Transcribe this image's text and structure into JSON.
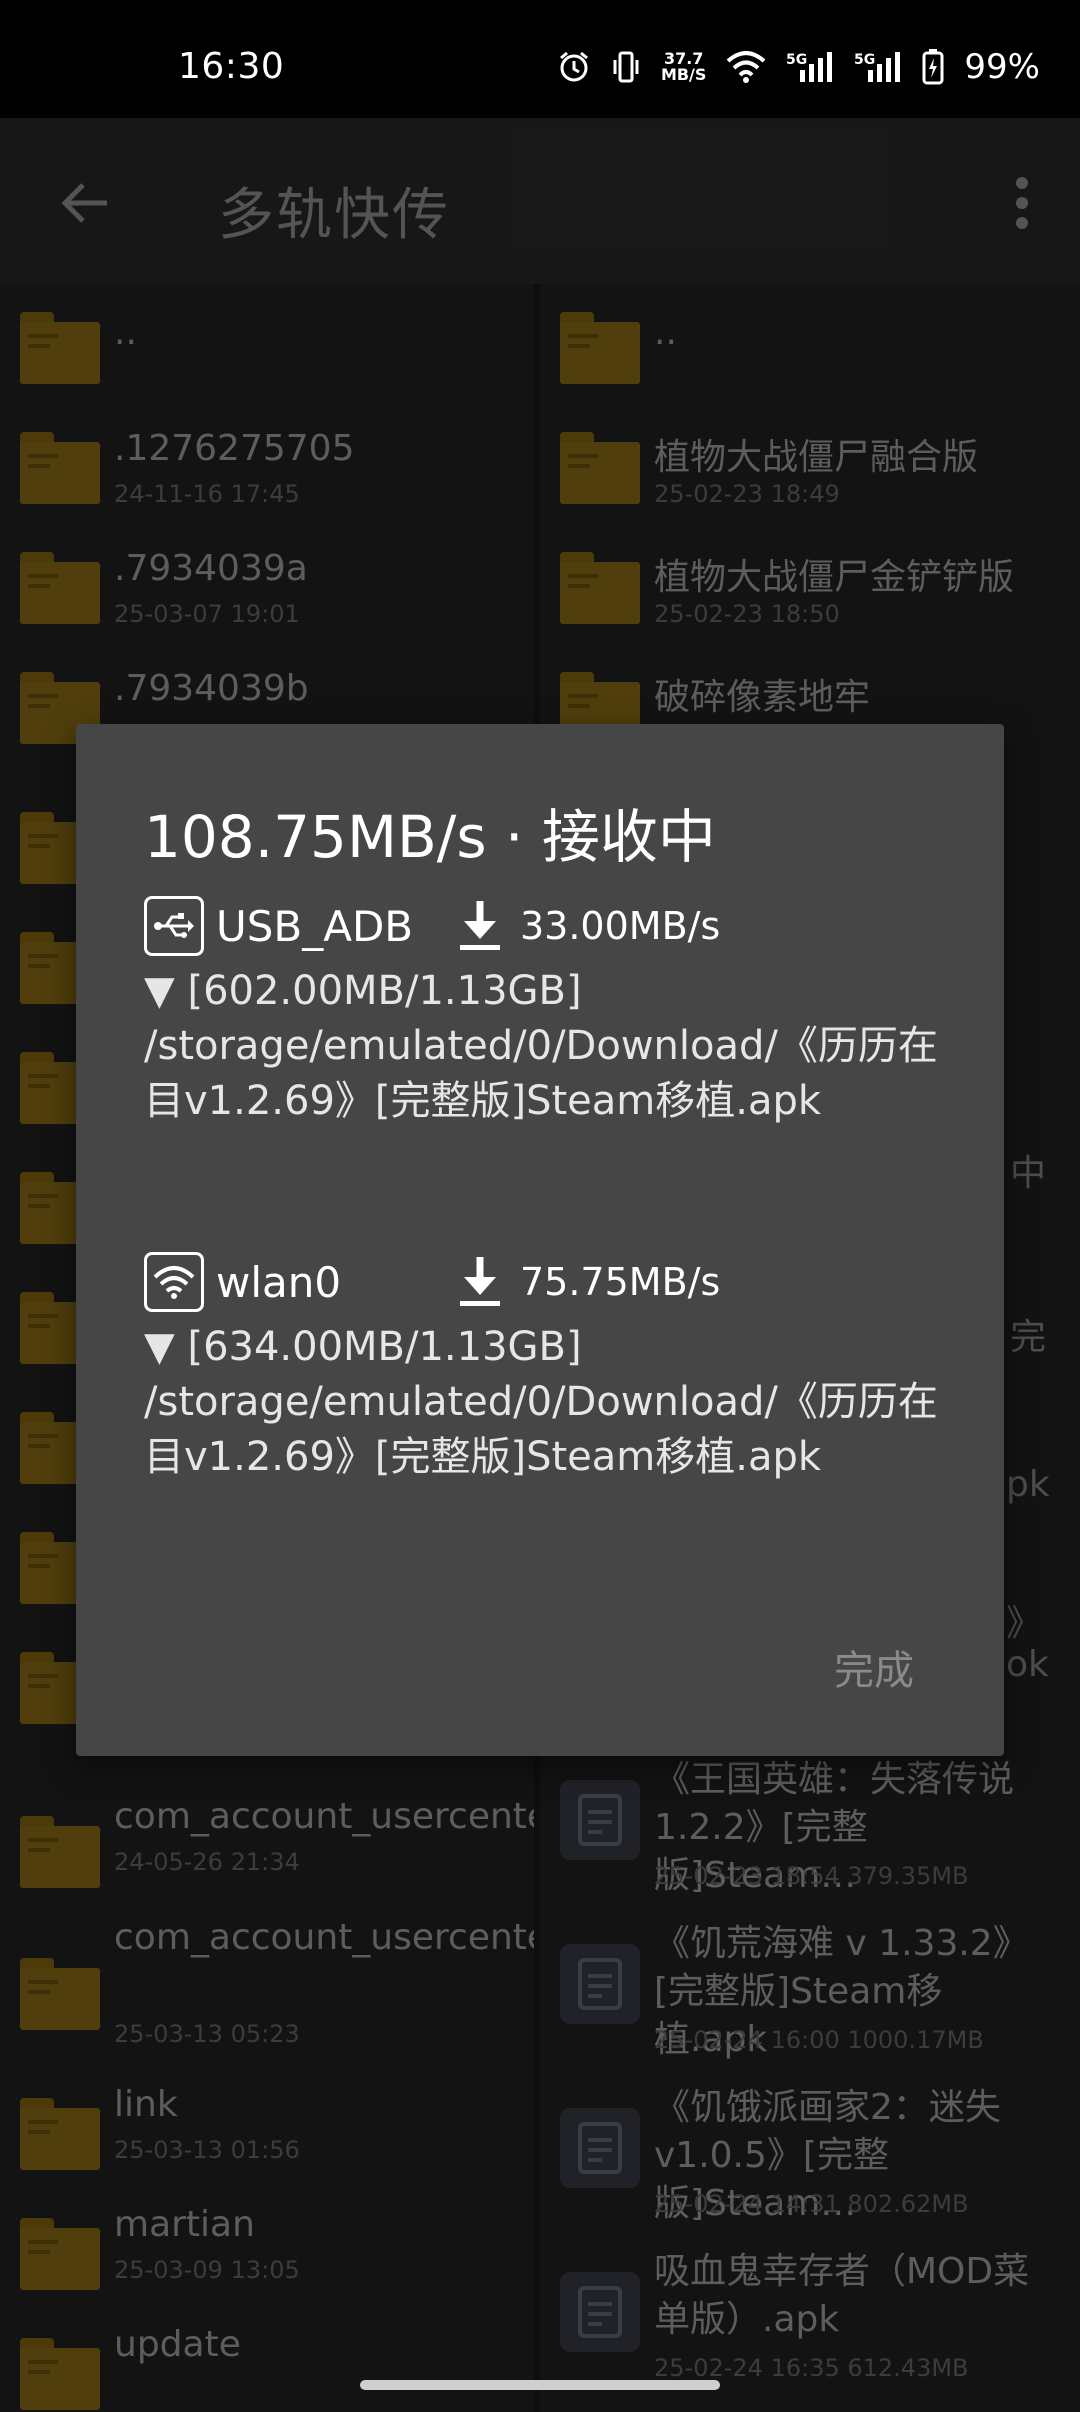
{
  "status_bar": {
    "time": "16:30",
    "net_speed_value": "37.7",
    "net_speed_unit": "MB/S",
    "battery": "99%",
    "icons": [
      "alarm-icon",
      "vibrate-icon",
      "wifi-icon",
      "signal-5g-icon",
      "signal-5g-icon",
      "battery-charging-icon"
    ]
  },
  "app_bar": {
    "title": "多轨快传",
    "back_icon": "arrow-left-icon",
    "menu_icon": "more-vert-icon"
  },
  "left_pane": {
    "items": [
      {
        "name": "..",
        "meta": ""
      },
      {
        "name": ".1276275705",
        "meta": "24-11-16 17:45"
      },
      {
        "name": ".7934039a",
        "meta": "25-03-07 19:01"
      },
      {
        "name": ".7934039b",
        "meta": ""
      },
      {
        "name": "com_account_usercenter",
        "meta": "24-05-26 21:34"
      },
      {
        "name": "com_account_usercenter_new",
        "meta": "25-03-13 05:23"
      },
      {
        "name": "link",
        "meta": "25-03-13 01:56"
      },
      {
        "name": "martian",
        "meta": "25-03-09 13:05"
      },
      {
        "name": "update",
        "meta": ""
      }
    ]
  },
  "right_pane": {
    "folders": [
      {
        "name": "..",
        "meta": ""
      },
      {
        "name": "植物大战僵尸融合版",
        "meta": "25-02-23 18:49"
      },
      {
        "name": "植物大战僵尸金铲铲版",
        "meta": "25-02-23 18:50"
      },
      {
        "name": "破碎像素地牢",
        "meta": ""
      }
    ],
    "partial": {
      "p1": "中",
      "p2": "完",
      "p3": "pk",
      "p4": "》",
      "p5": "ok"
    },
    "files": [
      {
        "name": "《王国英雄：失落传说1.2.2》[完整版]Steam…",
        "meta": "25-02-23 18:54  379.35MB"
      },
      {
        "name": "《饥荒海难 v 1.33.2》[完整版]Steam移植.apk",
        "meta": "25-02-24 16:00  1000.17MB"
      },
      {
        "name": "《饥饿派画家2：迷失v1.0.5》[完整版]Steam…",
        "meta": "25-02-24 14:31  802.62MB"
      },
      {
        "name": "吸血鬼幸存者（MOD菜单版）.apk",
        "meta": "25-02-24 16:35  612.43MB"
      }
    ]
  },
  "dialog": {
    "title": "108.75MB/s · 接收中",
    "channels": [
      {
        "icon": "usb-icon",
        "name": "USB_ADB",
        "speed": "33.00MB/s",
        "progress": "▼ [602.00MB/1.13GB] /storage/emulated/0/Download/《历历在目v1.2.69》[完整版]Steam移植.apk"
      },
      {
        "icon": "wifi-icon",
        "name": "wlan0",
        "speed": "75.75MB/s",
        "progress": "▼ [634.00MB/1.13GB] /storage/emulated/0/Download/《历历在目v1.2.69》[完整版]Steam移植.apk"
      }
    ],
    "done_label": "完成"
  }
}
